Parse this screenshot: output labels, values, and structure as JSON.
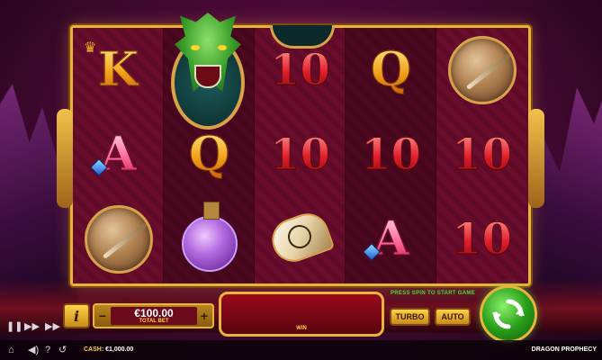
{
  "game": {
    "title": "DRAGON PROPHECY"
  },
  "reels": [
    [
      "K",
      "A",
      "shield"
    ],
    [
      "dragon",
      "Q",
      "potion"
    ],
    [
      "10",
      "10",
      "horn"
    ],
    [
      "Q",
      "10",
      "A"
    ],
    [
      "shield",
      "10",
      "10"
    ]
  ],
  "symbols": {
    "reel1_row1": "K",
    "reel1_row2": "A",
    "reel2_row2": "Q",
    "reel3_row1": "10",
    "reel3_row2": "10",
    "reel4_row1": "Q",
    "reel4_row2": "10",
    "reel4_row3": "A",
    "reel5_row2": "10",
    "reel5_row3": "10"
  },
  "controls": {
    "info_label": "i",
    "bet_minus": "−",
    "bet_plus": "+",
    "bet_amount": "€100.00",
    "bet_label": "TOTAL BET",
    "win_label": "WIN",
    "prompt": "PRESS SPIN TO START GAME",
    "turbo_label": "TURBO",
    "auto_label": "AUTO"
  },
  "footer": {
    "cash_label": "CASH:",
    "cash_value": "€1,000.00"
  },
  "icons": [
    "pause-icon",
    "play-icon",
    "fast-forward-icon",
    "home-icon",
    "sound-icon",
    "help-icon",
    "history-icon",
    "spin-arrows-icon",
    "crown-icon",
    "gem-icon"
  ],
  "colors": {
    "frame_gold": "#e9b23a",
    "spin_green": "#2aa01a",
    "prompt_green": "#4cd92a",
    "reel_red": "#5a0b26"
  }
}
